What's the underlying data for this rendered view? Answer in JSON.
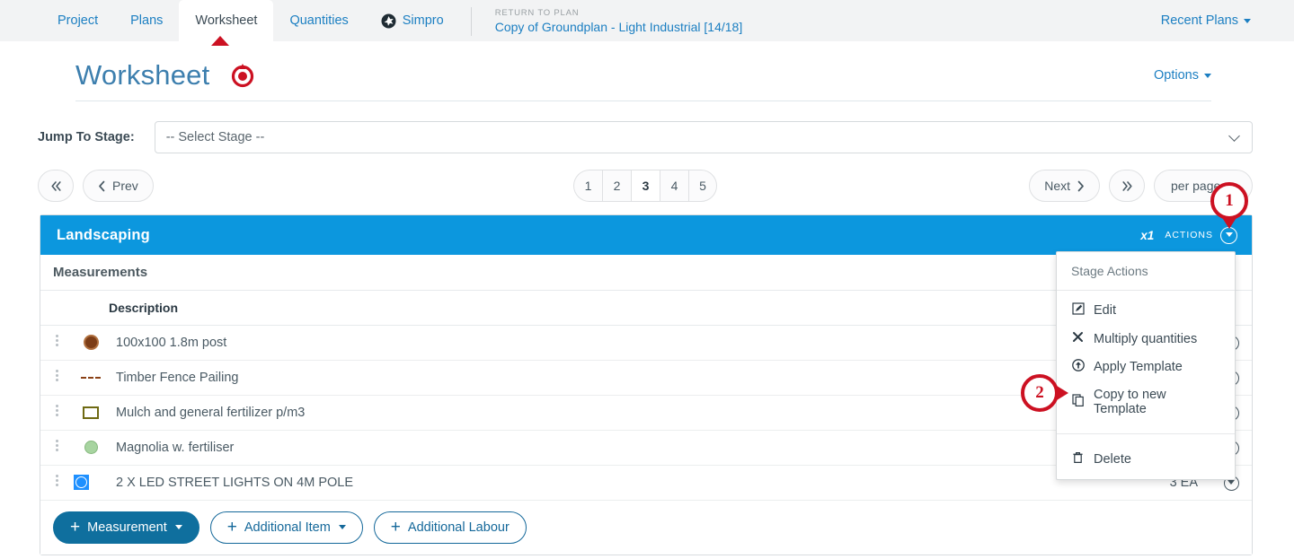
{
  "topnav": {
    "tabs": [
      {
        "label": "Project",
        "active": false,
        "icon": null
      },
      {
        "label": "Plans",
        "active": false,
        "icon": null
      },
      {
        "label": "Worksheet",
        "active": true,
        "icon": null
      },
      {
        "label": "Quantities",
        "active": false,
        "icon": null
      },
      {
        "label": "Simpro",
        "active": false,
        "icon": "simpro-logo"
      }
    ],
    "return_to_plan_label": "RETURN TO PLAN",
    "plan_name": "Copy of Groundplan - Light Industrial [14/18]",
    "recent_plans_label": "Recent Plans"
  },
  "header": {
    "title": "Worksheet",
    "options_label": "Options",
    "marker_icon": "record-target-icon"
  },
  "jump_to_stage": {
    "label": "Jump To Stage:",
    "selected": "-- Select Stage --",
    "chevron_icon": "chevron-down-icon"
  },
  "pagination": {
    "first_label": "«",
    "prev_label": "Prev",
    "next_label": "Next",
    "last_label": "»",
    "pages": [
      "1",
      "2",
      "3",
      "4",
      "5"
    ],
    "current_page": "3",
    "per_page_label": "per page"
  },
  "stage": {
    "name": "Landscaping",
    "multiplier": "x1",
    "actions_label": "ACTIONS",
    "actions_icon": "chevron-down-circle-icon",
    "section_label": "Measurements",
    "columns": [
      "",
      "",
      "Description",
      "",
      ""
    ],
    "description_header": "Description",
    "rows": [
      {
        "icon": "swatch-circle-brown",
        "description": "100x100 1.8m post",
        "qty": "",
        "action_icon": "chevron-down-circle-icon",
        "handle_icon": "drag-handle-icon"
      },
      {
        "icon": "swatch-dashed-line-brown",
        "description": "Timber Fence Pailing",
        "qty": "",
        "action_icon": "chevron-down-circle-icon",
        "handle_icon": "drag-handle-icon"
      },
      {
        "icon": "swatch-square-olive",
        "description": "Mulch and general fertilizer p/m3",
        "qty": "",
        "action_icon": "chevron-down-circle-icon",
        "handle_icon": "drag-handle-icon"
      },
      {
        "icon": "swatch-circle-green",
        "description": "Magnolia w. fertiliser",
        "qty": "",
        "action_icon": "chevron-down-circle-icon",
        "handle_icon": "drag-handle-icon"
      },
      {
        "icon": "swatch-square-blue",
        "description": "2 X LED STREET LIGHTS ON 4M POLE",
        "qty": "3 EA",
        "action_icon": "chevron-down-circle-icon",
        "handle_icon": "drag-handle-icon"
      }
    ],
    "footer_buttons": [
      {
        "label": "Measurement",
        "style": "primary",
        "has_caret": true
      },
      {
        "label": "Additional Item",
        "style": "outline",
        "has_caret": true
      },
      {
        "label": "Additional Labour",
        "style": "outline",
        "has_caret": false
      }
    ]
  },
  "dropdown": {
    "title": "Stage Actions",
    "items": [
      {
        "label": "Edit",
        "icon": "edit-pencil-square-icon"
      },
      {
        "label": "Multiply quantities",
        "icon": "multiply-x-icon"
      },
      {
        "label": "Apply Template",
        "icon": "arrow-up-circle-icon"
      },
      {
        "label": "Copy to new Template",
        "icon": "copy-icon"
      }
    ],
    "danger_items": [
      {
        "label": "Delete",
        "icon": "trash-icon"
      }
    ]
  },
  "annotations": [
    {
      "number": "1",
      "target": "stage-actions-toggle",
      "direction": "down"
    },
    {
      "number": "2",
      "target": "dropdown-item-copy-to-new-template",
      "direction": "right"
    }
  ],
  "colors": {
    "stage_header_blue": "#0c97de",
    "link_blue": "#1c7fc2",
    "primary_button": "#0f6f9e",
    "title_blue": "#3d7fae",
    "marker_red": "#cc1122"
  }
}
